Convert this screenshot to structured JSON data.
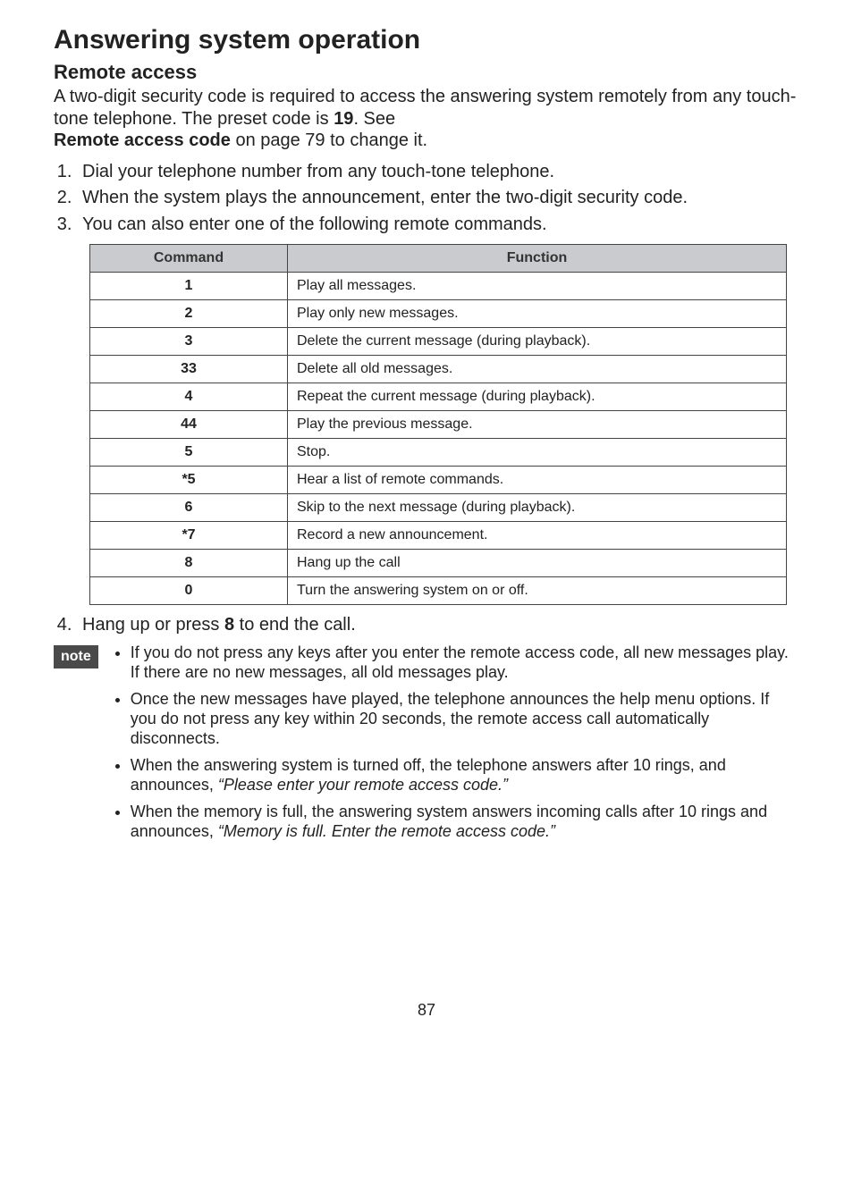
{
  "title": "Answering system operation",
  "section": "Remote access",
  "intro_parts": {
    "p1a": "A two-digit security code is required to access the answering system remotely from any touch-tone telephone. The preset code is ",
    "preset_code": "19",
    "p1b": ". See ",
    "ref_bold": "Remote access code",
    "p1c": " on page 79 to change it."
  },
  "steps": {
    "s1": "Dial your telephone number from any touch-tone telephone.",
    "s2": "When the system plays the announcement, enter the two-digit security code.",
    "s3": "You can also enter one of the following remote commands.",
    "s4a": "Hang up or press ",
    "s4key": "8",
    "s4b": " to end the call."
  },
  "table": {
    "hdr_cmd": "Command",
    "hdr_fn": "Function",
    "rows": [
      {
        "cmd": "1",
        "fn": "Play all messages."
      },
      {
        "cmd": "2",
        "fn": "Play only new messages."
      },
      {
        "cmd": "3",
        "fn": "Delete the current message (during playback)."
      },
      {
        "cmd": "33",
        "fn": "Delete all old messages."
      },
      {
        "cmd": "4",
        "fn": "Repeat the current message (during playback)."
      },
      {
        "cmd": "44",
        "fn": "Play the previous message."
      },
      {
        "cmd": "5",
        "fn": "Stop."
      },
      {
        "cmd": "*5",
        "fn": "Hear a list of remote commands."
      },
      {
        "cmd": "6",
        "fn": "Skip to the next message (during playback)."
      },
      {
        "cmd": "*7",
        "fn": "Record a new announcement."
      },
      {
        "cmd": "8",
        "fn": "Hang up the call"
      },
      {
        "cmd": "0",
        "fn": "Turn the answering system on or off."
      }
    ]
  },
  "note_label": "note",
  "notes": {
    "n1": "If you do not press any keys after you enter the remote access code, all new messages play. If there are no new messages, all old messages play.",
    "n2": "Once the new messages have played, the telephone announces the help menu options. If you do not press any key within 20 seconds, the remote access call automatically disconnects.",
    "n3a": "When the answering system is turned off, the telephone answers after 10 rings, and announces, ",
    "n3i": "“Please enter your remote access code.”",
    "n4a": "When the memory is full, the answering system answers incoming calls after 10 rings and announces, ",
    "n4i": "“Memory is full. Enter the remote access code.”"
  },
  "page_number": "87"
}
